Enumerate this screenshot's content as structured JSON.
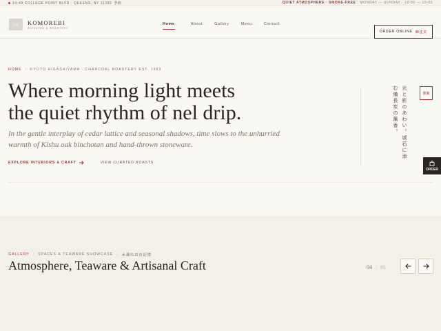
{
  "topbar": {
    "address": "44-49 COLLEGE POINT BLVD · QUEENS, NY 11355",
    "address_jp": "予約",
    "atmosphere": "QUIET ATMOSPHERE · SMOKE-FREE",
    "hours": "MONDAY — SUNDAY · 10:00 — 19:00"
  },
  "brand": {
    "mark": "木漏",
    "name": "KOMOREBI",
    "sub": "KISSATEN & ROASTERY"
  },
  "nav": {
    "items": [
      "Home",
      "About",
      "Gallery",
      "Menu",
      "Contact"
    ]
  },
  "order_button": {
    "label": "ORDER ONLINE",
    "label_jp": "御注文"
  },
  "hero": {
    "crumb_home": "HOME",
    "crumb_detail": "KYOTO HIGASHIYAMA · CHARCOAL ROASTERY EST. 1983",
    "headline_line1": "Where morning light meets",
    "headline_line2": "the quiet rhythm of nel drip.",
    "lead": "In the gentle interplay of cedar lattice and seasonal shadows, time slows to the unhurried warmth of Kishu oak binchotan and hand-thrown stoneware.",
    "cta_primary": "EXPLORE INTERIORS & CRAFT",
    "cta_secondary": "VIEW CURATED ROASTS",
    "vertical_text": "光と影のあわい。城石に添む備長炭の薫香。",
    "seal": "茶房"
  },
  "float_order": {
    "label": "ORDER"
  },
  "gallery": {
    "crumb_first": "GALLERY",
    "crumb_second": "SPACES & TEAWARE SHOWCASE",
    "crumb_jp": "木漏れ日の記憶",
    "title": "Atmosphere, Teaware & Artisanal Craft",
    "current": "04",
    "total": "05"
  },
  "colors": {
    "accent": "#b0322e",
    "ink": "#2b2622",
    "paper": "#faf8f3",
    "gallery_bg": "#f3f0e7"
  }
}
